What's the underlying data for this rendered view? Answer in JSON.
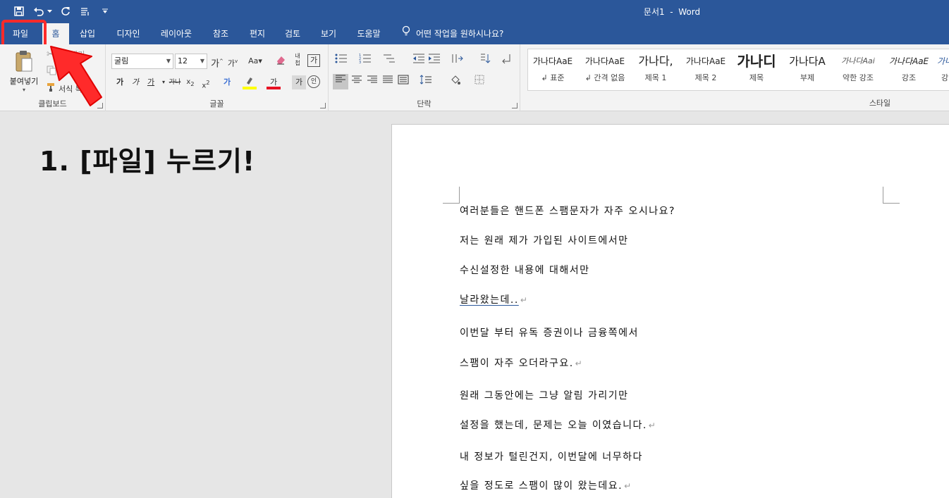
{
  "app": {
    "doc_title": "문서1",
    "app_name": "Word",
    "title_sep": "  -  "
  },
  "tabs": {
    "file": "파일",
    "home": "홈",
    "insert": "삽입",
    "design": "디자인",
    "layout": "레이아웃",
    "references": "참조",
    "mailings": "편지",
    "review": "검토",
    "view": "보기",
    "help": "도움말",
    "tell_me": "어떤 작업을 원하시나요?"
  },
  "clipboard": {
    "paste_label": "붙여넣기",
    "cut_label": "잘라내기",
    "format_painter_label": "서식 복사",
    "group_label": "클립보드"
  },
  "font": {
    "name": "굴림",
    "size": "12",
    "group_label": "글꼴"
  },
  "paragraph": {
    "group_label": "단락"
  },
  "styles": {
    "group_label": "스타일",
    "items": [
      {
        "sample": "가나다AaE",
        "name": "↲ 표준"
      },
      {
        "sample": "가나다AaE",
        "name": "↲ 간격 없음"
      },
      {
        "sample": "가나다,",
        "name": "제목 1"
      },
      {
        "sample": "가나다AaE",
        "name": "제목 2"
      },
      {
        "sample": "가나디",
        "name": "제목"
      },
      {
        "sample": "가나다A",
        "name": "부제"
      },
      {
        "sample": "가나다Aai",
        "name": "약한 강조"
      },
      {
        "sample": "가나다AaE",
        "name": "강조"
      },
      {
        "sample": "가나",
        "name": "강"
      }
    ]
  },
  "annotation": {
    "text": "1. [파일] 누르기!"
  },
  "document": {
    "paragraphs": [
      "여러분들은 핸드폰 스팸문자가 자주 오시나요?",
      "저는 원래 제가 가입된 사이트에서만",
      "수신설정한 내용에 대해서만",
      "날라왔는데..",
      "이번달 부터 유독 증권이나 금융쪽에서",
      "스팸이 자주 오더라구요.",
      "원래 그동안에는 그냥 알림 가리기만",
      "설정을 했는데, 문제는 오늘 이였습니다.",
      "내 정보가 털린건지, 이번달에 너무하다",
      "싶을 정도로 스팸이 많이 왔는데요."
    ],
    "para_mark": "↵"
  },
  "colors": {
    "title_bar": "#2b579a",
    "ribbon": "#f3f3f3",
    "highlight": "#ff2a2a"
  }
}
